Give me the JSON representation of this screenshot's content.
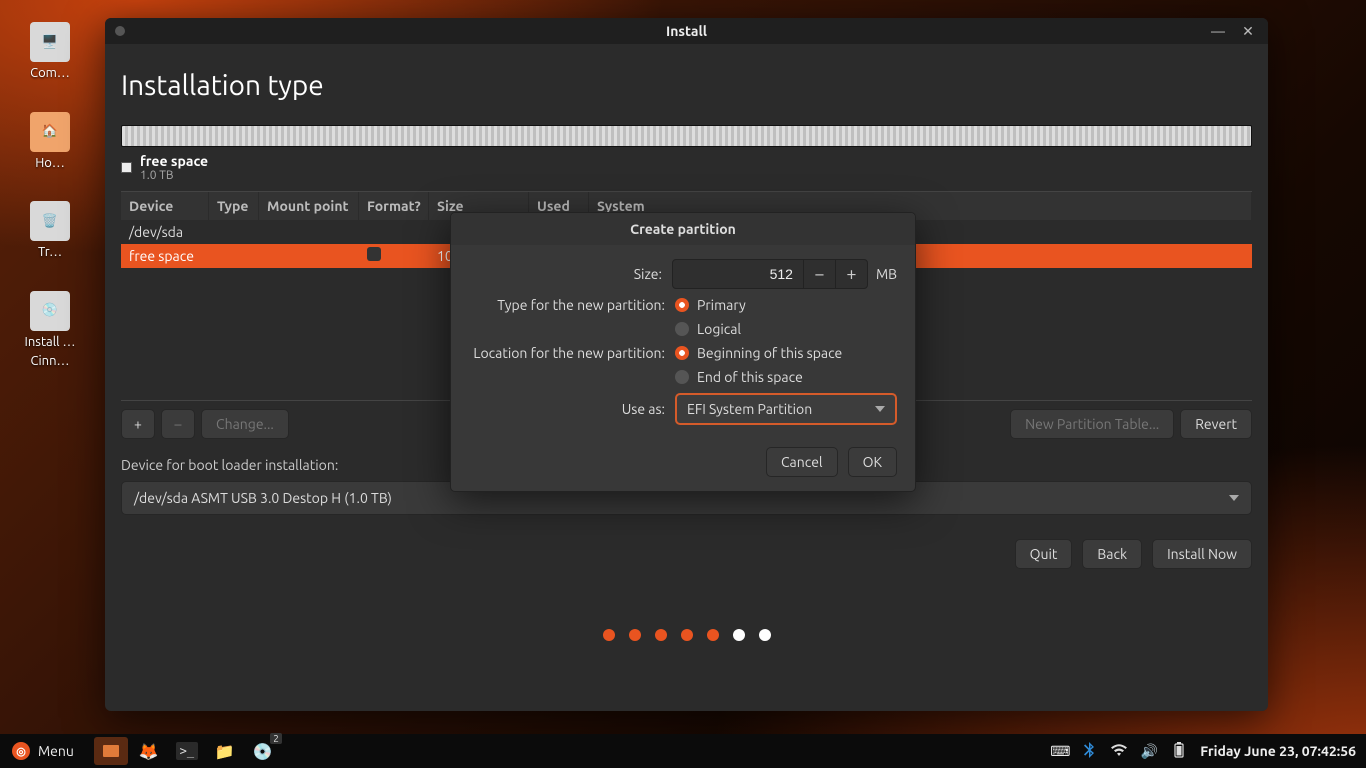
{
  "desktop_icons": [
    {
      "label": "Com…",
      "name": "computer-icon"
    },
    {
      "label": "Ho…",
      "name": "home-icon"
    },
    {
      "label": "Tr…",
      "name": "trash-icon"
    },
    {
      "label": "Install …",
      "label2": "Cinn…",
      "name": "installer-launcher-icon"
    }
  ],
  "window": {
    "title": "Install",
    "page_title": "Installation type",
    "partition_bar": {
      "name": "free space",
      "size": "1.0 TB"
    },
    "columns": {
      "device": "Device",
      "type": "Type",
      "mount": "Mount point",
      "format": "Format?",
      "size": "Size",
      "used": "Used",
      "system": "System"
    },
    "rows": [
      {
        "device": "/dev/sda",
        "selected": false
      },
      {
        "device": " free space",
        "selected": true,
        "size_partial": "100"
      }
    ],
    "table_actions": {
      "plus": "+",
      "minus": "–",
      "change": "Change...",
      "newpt": "New Partition Table...",
      "revert": "Revert"
    },
    "boot_label": "Device for boot loader installation:",
    "boot_value": "/dev/sda   ASMT USB 3.0 Destop H (1.0 TB)",
    "nav": {
      "quit": "Quit",
      "back": "Back",
      "install": "Install Now"
    }
  },
  "modal": {
    "title": "Create partition",
    "size_label": "Size:",
    "size_value": "512",
    "size_unit": "MB",
    "type_label": "Type for the new partition:",
    "type_primary": "Primary",
    "type_logical": "Logical",
    "location_label": "Location for the new partition:",
    "loc_begin": "Beginning of this space",
    "loc_end": "End of this space",
    "useas_label": "Use as:",
    "useas_value": "EFI System Partition",
    "cancel": "Cancel",
    "ok": "OK"
  },
  "taskbar": {
    "menu": "Menu",
    "clock": "Friday June 23, 07:42:56"
  }
}
